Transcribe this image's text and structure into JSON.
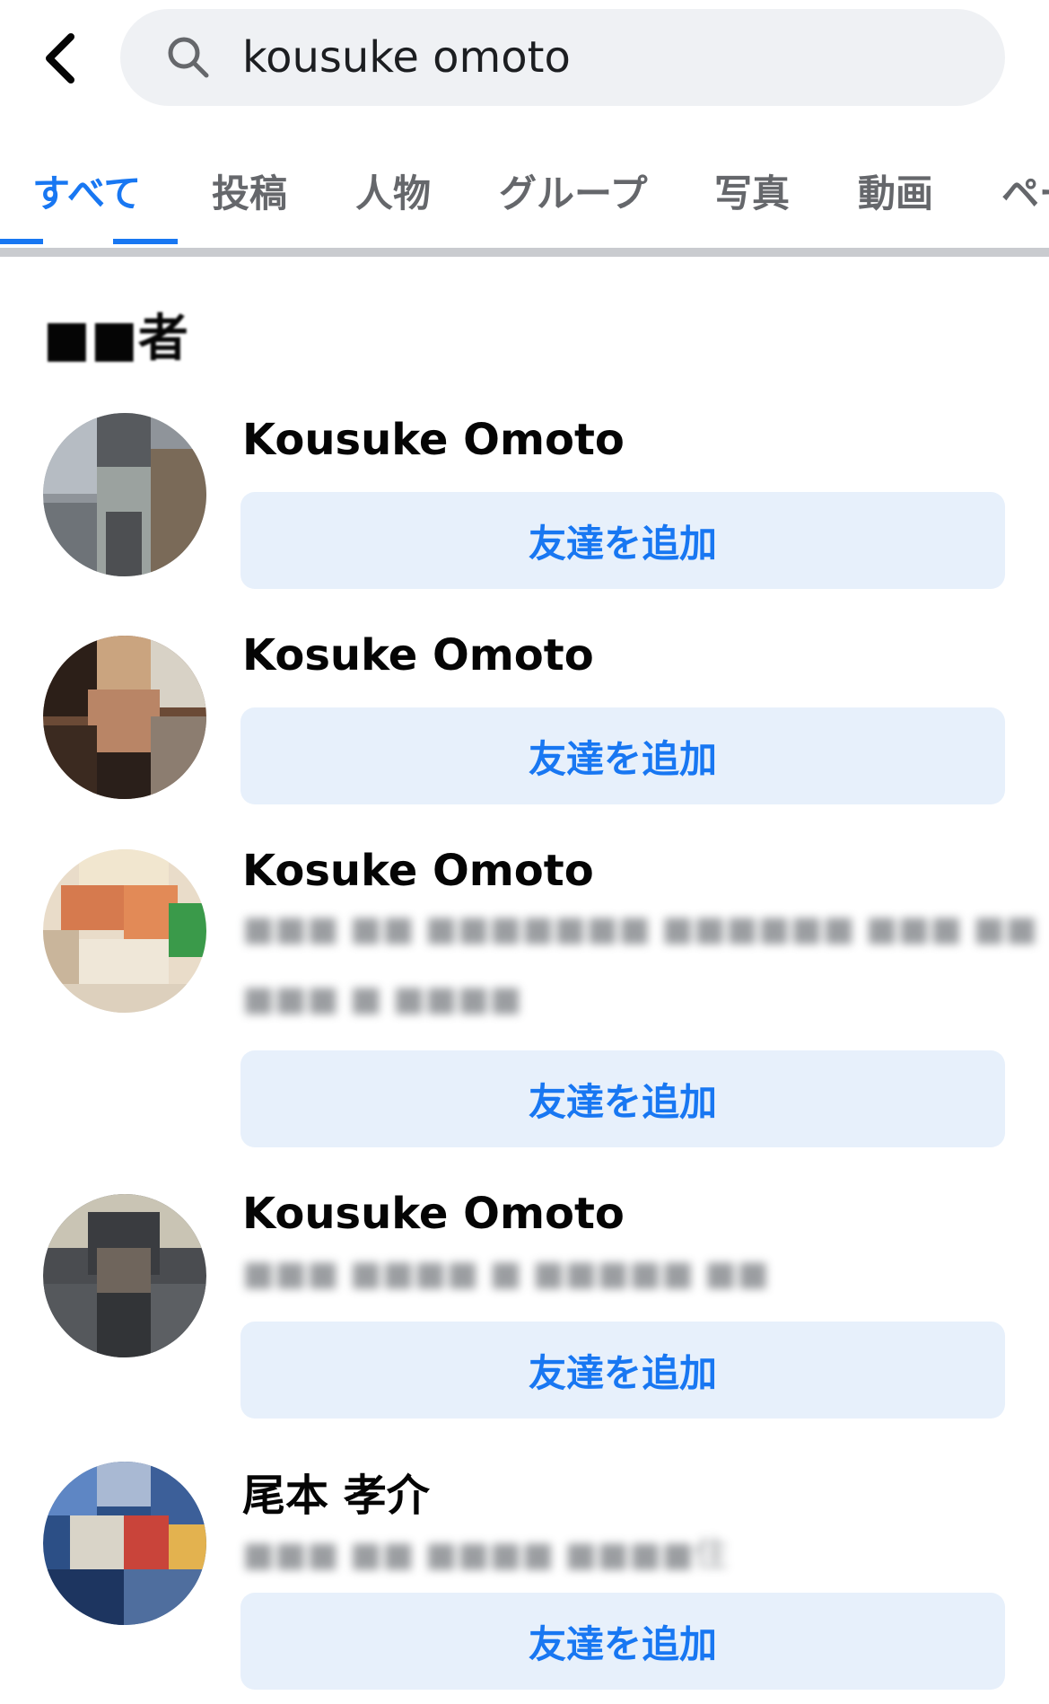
{
  "search": {
    "query": "kousuke omoto"
  },
  "tabs": [
    {
      "label": "すべて"
    },
    {
      "label": "投稿"
    },
    {
      "label": "人物"
    },
    {
      "label": "グループ"
    },
    {
      "label": "写真"
    },
    {
      "label": "動画"
    },
    {
      "label": "ペー"
    }
  ],
  "section": {
    "title": "■■者"
  },
  "people": [
    {
      "name": "Kousuke Omoto",
      "button": "友達を追加"
    },
    {
      "name": "Kosuke Omoto",
      "button": "友達を追加"
    },
    {
      "name": "Kosuke Omoto",
      "subtitle_1": "■■■ ■■ ■■■■■■■ ■■■■■■ ■■■ ■■",
      "subtitle_2": "■■■ ■ ■■■■",
      "button": "友達を追加"
    },
    {
      "name": "Kousuke Omoto",
      "subtitle_1": "■■■ ■■■■ ■ ■■■■■ ■■",
      "button": "友達を追加"
    },
    {
      "name": "尾本 孝介",
      "subtitle_1": "■■■ ■■ ■■■■ ■■■■住",
      "button": "友達を追加"
    }
  ],
  "colors": {
    "accent": "#1877f2",
    "button_bg": "#e7f0fb",
    "search_bg": "#eff1f4",
    "tab_inactive": "#65676b"
  },
  "icons": {
    "back": "chevron-left-icon",
    "search": "search-icon"
  }
}
